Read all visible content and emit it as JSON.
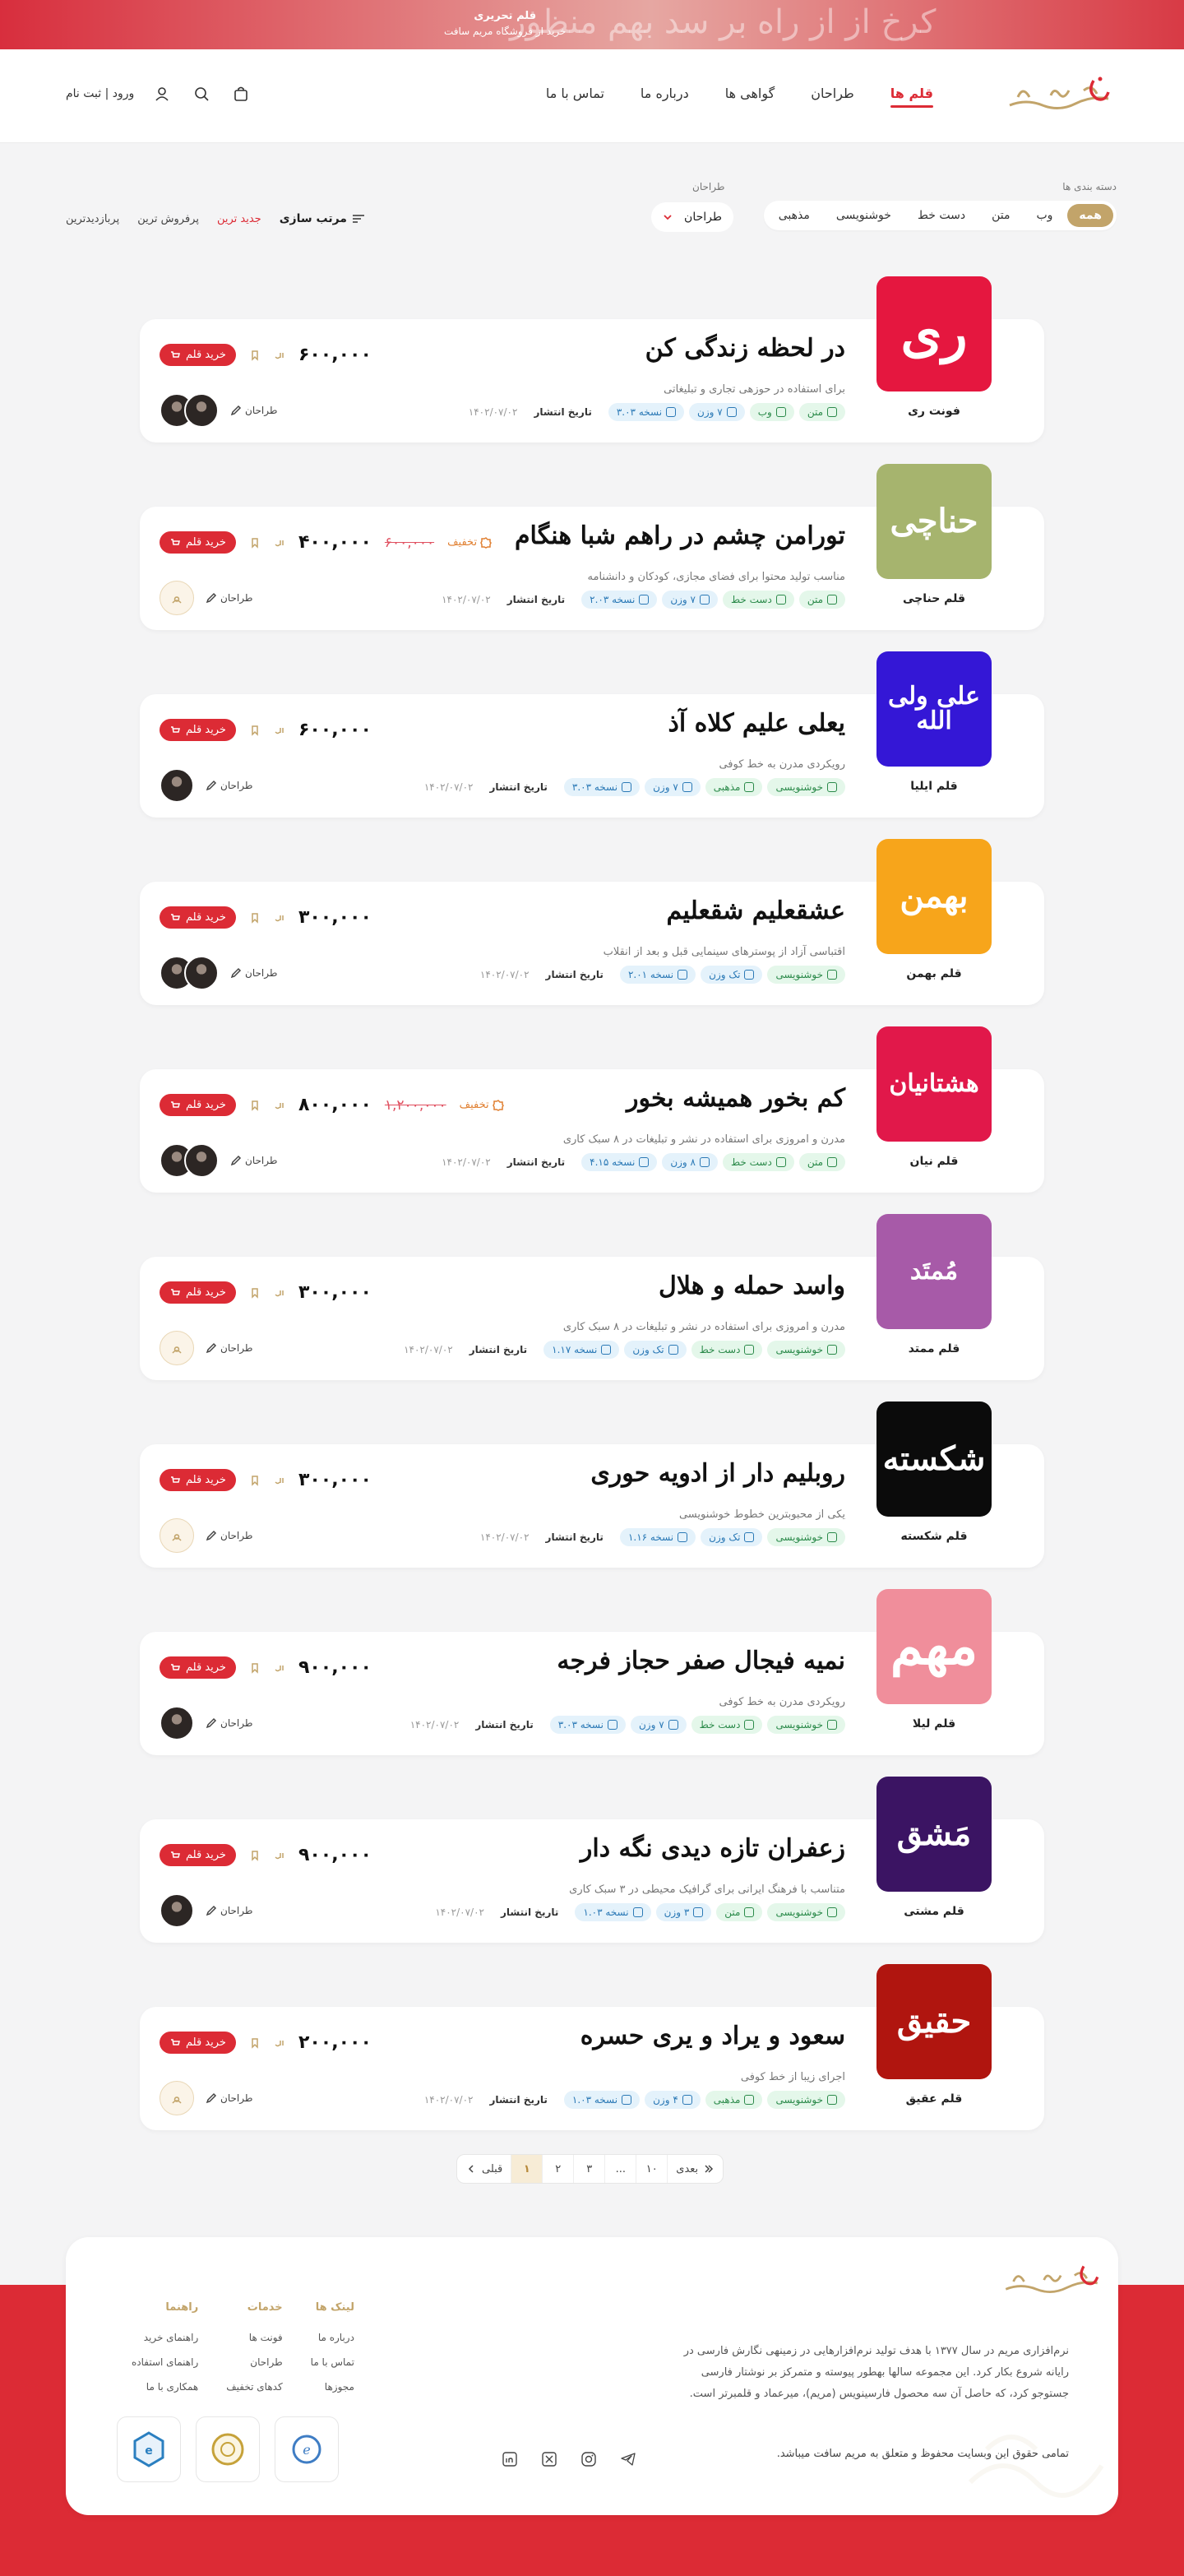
{
  "topbar": {
    "bg_script": "کرخ از از راه بر سد بهم منظور",
    "promo_title": "قلم تحریری",
    "promo_sub": "خرید از فروشگاه مریم سافت"
  },
  "header": {
    "logo_text": "نرم‌افزاری مریم",
    "nav": [
      "قلم ها",
      "طراحان",
      "گواهی ها",
      "درباره ما",
      "تماس با ما"
    ],
    "active_nav": "قلم ها",
    "login_label": "ورود | ثبت نام",
    "icons": [
      "user-icon",
      "search-icon",
      "cart-icon"
    ]
  },
  "filters": {
    "category_label": "دسته بندی ها",
    "categories": [
      "همه",
      "وب",
      "متن",
      "دست خط",
      "خوشنویسی",
      "مذهبی"
    ],
    "active_category": "همه",
    "designer_label": "طراحان",
    "designer_select": "طراحان",
    "sort_title": "مرتب سازی",
    "sort_options": [
      "جدید ترین",
      "پرفروش ترین",
      "پربازدیدترین"
    ],
    "active_sort": "جدید ترین"
  },
  "common": {
    "buy_label": "خرید قلم",
    "currency": "تومان",
    "designer_label": "طراحان",
    "pub_label": "تاریخ انتشار",
    "discount_label": "تخفیف"
  },
  "products": [
    {
      "thumb_text": "ری",
      "thumb_bg": "#e5173f",
      "name": "فونت ری",
      "sample": "در لحظه زندگی کن",
      "desc": "برای استفاده در حوزهی تجاری و تبلیغاتی",
      "badges": [
        "متن",
        "وب",
        "۷ وزن",
        "نسخه ۳.۰۳"
      ],
      "pub_date": "۱۴۰۲/۰۷/۰۲",
      "price": "۶۰۰,۰۰۰",
      "old_price": "",
      "discount": false,
      "avatars": [
        "photo",
        "photo"
      ]
    },
    {
      "thumb_text": "حناچی",
      "thumb_bg": "#a6b46e",
      "name": "قلم حناچی",
      "sample": "تورامن چشم در راهم شبا هنگام",
      "desc": "مناسب تولید محتوا برای فضای مجازی، کودکان و دانشنامه",
      "badges": [
        "متن",
        "دست خط",
        "۷ وزن",
        "نسخه ۲.۰۳"
      ],
      "pub_date": "۱۴۰۲/۰۷/۰۲",
      "price": "۴۰۰,۰۰۰",
      "old_price": "۶۰۰,۰۰۰",
      "discount": true,
      "avatars": [
        "placeholder"
      ]
    },
    {
      "thumb_text": "علی ولی الله",
      "thumb_bg": "#3417d6",
      "name": "قلم ایلیا",
      "sample": "یعلی علیم کلاه آذ",
      "desc": "رویکردی مدرن به خط کوفی",
      "badges": [
        "خوشنویسی",
        "مذهبی",
        "۷ وزن",
        "نسخه ۳.۰۳"
      ],
      "pub_date": "۱۴۰۲/۰۷/۰۲",
      "price": "۶۰۰,۰۰۰",
      "old_price": "",
      "discount": false,
      "avatars": [
        "photo"
      ]
    },
    {
      "thumb_text": "بهمن",
      "thumb_bg": "#f7a51b",
      "name": "قلم بهمن",
      "sample": "عشقعلیم شقعلیم",
      "desc": "اقتباسی آزاد از پوسترهای سینمایی قبل و بعد از انقلاب",
      "badges": [
        "خوشنویسی",
        "تک وزن",
        "نسخه ۲.۰۱"
      ],
      "pub_date": "۱۴۰۲/۰۷/۰۲",
      "price": "۳۰۰,۰۰۰",
      "old_price": "",
      "discount": false,
      "avatars": [
        "photo",
        "photo"
      ]
    },
    {
      "thumb_text": "هشتانیان",
      "thumb_bg": "#e1184a",
      "name": "قلم نیان",
      "sample": "کم بخور همیشه بخور",
      "desc": "مدرن و امروزی برای استفاده در نشر و تبلیغات در ۸ سبک کاری",
      "badges": [
        "متن",
        "دست خط",
        "۸ وزن",
        "نسخه ۴.۱۵"
      ],
      "pub_date": "۱۴۰۲/۰۷/۰۲",
      "price": "۸۰۰,۰۰۰",
      "old_price": "۱,۲۰۰,۰۰۰",
      "discount": true,
      "avatars": [
        "photo",
        "photo"
      ]
    },
    {
      "thumb_text": "مُمتَد",
      "thumb_bg": "#a75aa8",
      "name": "قلم ممتد",
      "sample": "واسد حمله و هلال",
      "desc": "مدرن و امروزی برای استفاده در نشر و تبلیغات در ۸ سبک کاری",
      "badges": [
        "خوشنویسی",
        "دست خط",
        "تک وزن",
        "نسخه ۱.۱۷"
      ],
      "pub_date": "۱۴۰۲/۰۷/۰۲",
      "price": "۳۰۰,۰۰۰",
      "old_price": "",
      "discount": false,
      "avatars": [
        "placeholder"
      ]
    },
    {
      "thumb_text": "شکسته",
      "thumb_bg": "#0b0b0b",
      "name": "قلم شکسته",
      "sample": "روبلیم دار از ادویه حوری",
      "desc": "یکی از محبوبترین خطوط خوشنویسی",
      "badges": [
        "خوشنویسی",
        "تک وزن",
        "نسخه ۱.۱۶"
      ],
      "pub_date": "۱۴۰۲/۰۷/۰۲",
      "price": "۳۰۰,۰۰۰",
      "old_price": "",
      "discount": false,
      "avatars": [
        "placeholder"
      ]
    },
    {
      "thumb_text": "مهم",
      "thumb_bg": "#f08e9b",
      "name": "قلم لیلا",
      "sample": "نمیه فیجال صفر حجاز فرجه",
      "desc": "رویکردی مدرن به خط کوفی",
      "badges": [
        "خوشنویسی",
        "دست خط",
        "۷ وزن",
        "نسخه ۳.۰۳"
      ],
      "pub_date": "۱۴۰۲/۰۷/۰۲",
      "price": "۹۰۰,۰۰۰",
      "old_price": "",
      "discount": false,
      "avatars": [
        "photo"
      ]
    },
    {
      "thumb_text": "مَشق",
      "thumb_bg": "#3b1463",
      "name": "قلم مشتی",
      "sample": "زعفران تازه دیدی نگه دار",
      "desc": "متناسب با فرهنگ ایرانی برای گرافیک محیطی در ۳ سبک کاری",
      "badges": [
        "خوشنویسی",
        "متن",
        "۳ وزن",
        "نسخه ۱.۰۳"
      ],
      "pub_date": "۱۴۰۲/۰۷/۰۲",
      "price": "۹۰۰,۰۰۰",
      "old_price": "",
      "discount": false,
      "avatars": [
        "photo"
      ]
    },
    {
      "thumb_text": "حقیق",
      "thumb_bg": "#b0150f",
      "name": "قلم عقیق",
      "sample": "سعود و یراد و یری حسره",
      "desc": "اجرای زیبا از خط کوفی",
      "badges": [
        "خوشنویسی",
        "مذهبی",
        "۴ وزن",
        "نسخه ۱.۰۳"
      ],
      "pub_date": "۱۴۰۲/۰۷/۰۲",
      "price": "۲۰۰,۰۰۰",
      "old_price": "",
      "discount": false,
      "avatars": [
        "placeholder"
      ]
    }
  ],
  "pagination": {
    "prev": "قبلی",
    "pages": [
      "۱",
      "۲",
      "۳",
      "...",
      "۱۰"
    ],
    "next": "بعدی",
    "active": "۱"
  },
  "footer": {
    "logo_text": "نرم‌افزاری مریم",
    "about": "نرم‌افزاری مریم در سال ۱۳۷۷ با هدف تولید نرم‌افزارهایی در زمینهی نگارش فارسی در رایانه شروع بکار کرد. این مجموعه سالها بهطور پیوسته و متمرکز بر نوشتار فارسی جستوجو کرد، که حاصل آن سه محصول فارسینویس (مریم)، میرعماد و قلمبرتر است.",
    "copyright": "تمامی حقوق این وبسایت محفوظ و متعلق به مریم سافت میباشد.",
    "columns": [
      {
        "title": "لینک ها",
        "links": [
          "درباره ما",
          "تماس با ما",
          "مجوزها"
        ]
      },
      {
        "title": "خدمات",
        "links": [
          "فونت ها",
          "طراحان",
          "کدهای تخفیف"
        ]
      },
      {
        "title": "راهنما",
        "links": [
          "راهنمای خرید",
          "راهنمای استفاده",
          "همکاری با ما"
        ]
      }
    ],
    "social": [
      "linkedin-icon",
      "x-icon",
      "instagram-icon",
      "telegram-icon"
    ],
    "trust": [
      "enamad-badge",
      "samandehi-badge",
      "etehadie-badge"
    ],
    "colors": {
      "brand": "#dc2b35",
      "gold": "#c2a46a"
    }
  }
}
